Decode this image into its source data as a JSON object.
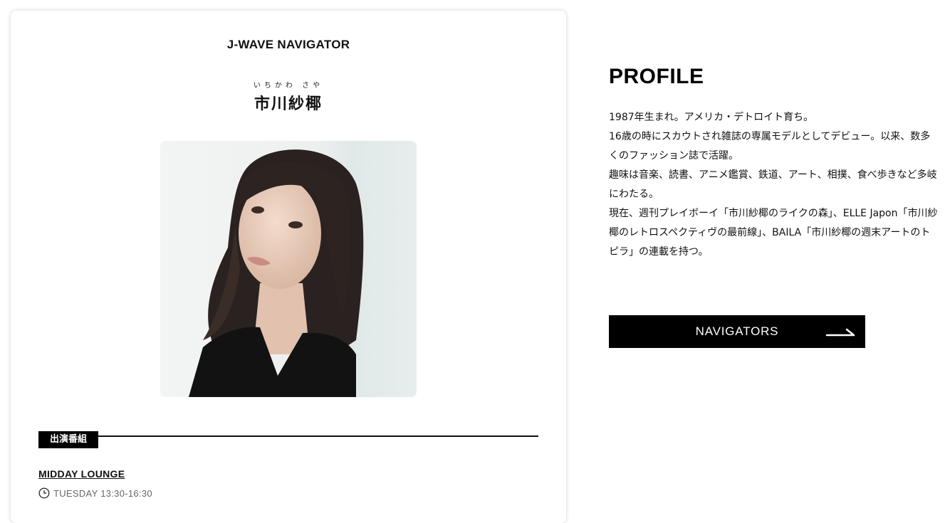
{
  "brand": {
    "title": "J-WAVE NAVIGATOR"
  },
  "navigator": {
    "ruby": "いちかわ さや",
    "name": "市川紗椰"
  },
  "programs": {
    "heading": "出演番組",
    "items": [
      {
        "title": "MIDDAY LOUNGE",
        "schedule": "TUESDAY 13:30-16:30"
      }
    ]
  },
  "profile": {
    "heading": "PROFILE",
    "paragraphs": [
      "1987年生まれ。アメリカ・デトロイト育ち。",
      "16歳の時にスカウトされ雑誌の専属モデルとしてデビュー。以来、数多くのファッション誌で活躍。",
      "趣味は音楽、読書、アニメ鑑賞、鉄道、アート、相撲、食べ歩きなど多岐にわたる。",
      "現在、週刊プレイボーイ「市川紗椰のライクの森」、ELLE Japon「市川紗椰のレトロスペクティヴの最前線」、BAILA「市川紗椰の週末アートのトピラ」の連載を持つ。"
    ]
  },
  "nav_button": {
    "label": "NAVIGATORS"
  },
  "icons": {
    "clock": "clock-icon",
    "arrow": "arrow-right-icon"
  },
  "colors": {
    "accent": "#000000",
    "muted": "#666666"
  }
}
